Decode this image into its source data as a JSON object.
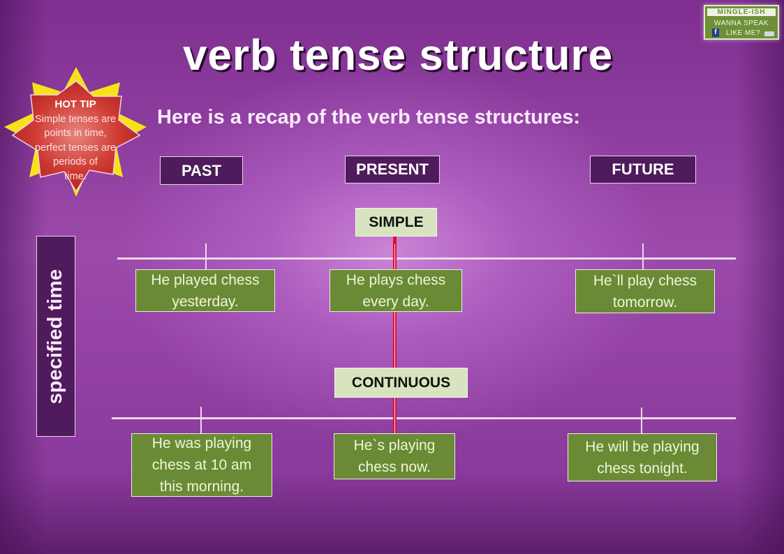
{
  "title": "verb tense structure",
  "subtitle": "Here is a recap of the verb tense structures:",
  "badge": {
    "brand": "MINGLE-ISH",
    "line1": "WANNA SPEAK",
    "line2": "LIKE ME?",
    "facebook_icon": "f"
  },
  "hot_tip": {
    "heading": "HOT TIP",
    "lines": [
      "Simple tenses are",
      "points in time,",
      "perfect tenses are",
      "periods of",
      "time."
    ]
  },
  "tenses": {
    "past": "PAST",
    "present": "PRESENT",
    "future": "FUTURE"
  },
  "side_label": "specified time",
  "aspects": {
    "simple": {
      "label": "SIMPLE",
      "examples": {
        "past": [
          "He played chess",
          "yesterday."
        ],
        "present": [
          "He plays chess",
          "every day."
        ],
        "future": [
          "He`ll play chess",
          "tomorrow."
        ]
      }
    },
    "continuous": {
      "label": "CONTINUOUS",
      "examples": {
        "past": [
          "He was playing",
          "chess at 10 am",
          "this morning."
        ],
        "present": [
          "He`s playing",
          "chess now."
        ],
        "future": [
          "He will be playing",
          "chess tonight."
        ]
      }
    }
  },
  "colors": {
    "tense_box": "#4f1b5c",
    "aspect_box": "#d7e4bf",
    "example_box": "#6b8a35",
    "present_line": "#e0102a",
    "star_outer": "#f7e21a",
    "star_inner": "#c9302c"
  }
}
